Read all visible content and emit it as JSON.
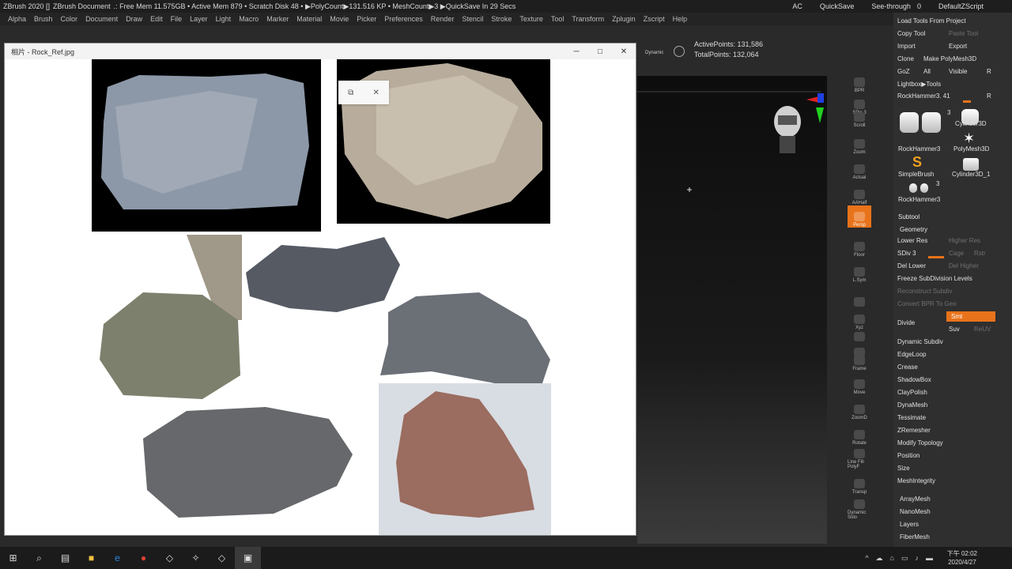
{
  "titlebar": {
    "app": "ZBrush 2020 []",
    "doc": "ZBrush Document",
    "stats": ".: Free Mem 11.575GB • Active Mem 879 • Scratch Disk 48 • ▶PolyCount▶131.516 KP • MeshCount▶3 ▶QuickSave In 29 Secs",
    "ac": "AC",
    "quicksave": "QuickSave",
    "seethrough": "See-through",
    "seethrough_val": "0",
    "script": "DefaultZScript"
  },
  "menu": [
    "Alpha",
    "Brush",
    "Color",
    "Document",
    "Draw",
    "Edit",
    "File",
    "Layer",
    "Light",
    "Macro",
    "Marker",
    "Material",
    "Movie",
    "Picker",
    "Preferences",
    "Render",
    "Stencil",
    "Stroke",
    "Texture",
    "Tool",
    "Transform",
    "Zplugin",
    "Zscript",
    "Help"
  ],
  "info": {
    "active_points": "ActivePoints: 131,586",
    "total_points": "TotalPoints: 132,064",
    "dynamic": "Dynamic"
  },
  "viewer": {
    "title": "相片 - Rock_Ref.jpg",
    "minimize": "─",
    "maximize": "□",
    "close": "✕",
    "overlay_copy": "⧉",
    "overlay_close": "✕"
  },
  "tooldock": [
    "BPR",
    "SPix 3",
    "Scroll",
    "Zoom",
    "Actual",
    "AAHalf",
    "Persp",
    "Floor",
    "L.Sym",
    "",
    "Xyz",
    "",
    "",
    "Frame",
    "Move",
    "ZoomD",
    "Rotate",
    "Line Fill PolyF",
    "Transp",
    "Dynamic Solo"
  ],
  "spix": "SPix 3",
  "rpanel": {
    "load_tools": "Load Tools From Project",
    "copy_tool": "Copy Tool",
    "paste_tool": "Paste Tool",
    "import": "Import",
    "export": "Export",
    "clone": "Clone",
    "make_polymesh": "Make PolyMesh3D",
    "goz": "GoZ",
    "all": "All",
    "visible": "Visible",
    "r": "R",
    "lightbox": "Lightbox▶Tools",
    "current_tool": "RockHammer3. 41",
    "current_r": "R",
    "thumbs": [
      {
        "label": "RockHammer3",
        "badge": "3"
      },
      {
        "label": "Cylinder3D"
      },
      {
        "label": "PolyMesh3D"
      },
      {
        "label": "SimpleBrush"
      },
      {
        "label": "Cylinder3D_1"
      },
      {
        "label": "RockHammer3",
        "badge": "3"
      }
    ],
    "subtool": "Subtool",
    "geometry": "Geometry",
    "lower_res": "Lower Res",
    "higher_res": "Higher Res",
    "sdiv": "SDiv 3",
    "cage": "Cage",
    "rstr": "Rstr",
    "del_lower": "Del Lower",
    "del_higher": "Del Higher",
    "freeze": "Freeze SubDivision Levels",
    "reconstruct": "Reconstruct Subdiv",
    "convert_bpr": "Convert BPR To Geo",
    "divide": "Divide",
    "smt": "Smt",
    "suv": "Suv",
    "reuv": "ReUV",
    "items": [
      "Dynamic Subdiv",
      "EdgeLoop",
      "Crease",
      "ShadowBox",
      "ClayPolish",
      "DynaMesh",
      "Tessimate",
      "ZRemesher",
      "Modify Topology",
      "Position",
      "Size",
      "MeshIntegrity"
    ],
    "items2": [
      "ArrayMesh",
      "NanoMesh",
      "Layers",
      "FiberMesh"
    ]
  },
  "taskbar": {
    "start": "⊞",
    "search": "⌕",
    "clock_time": "下午 02:02",
    "clock_date": "2020/4/27"
  },
  "colors": {
    "accent": "#e8731a",
    "panel": "#2f2f2f"
  }
}
